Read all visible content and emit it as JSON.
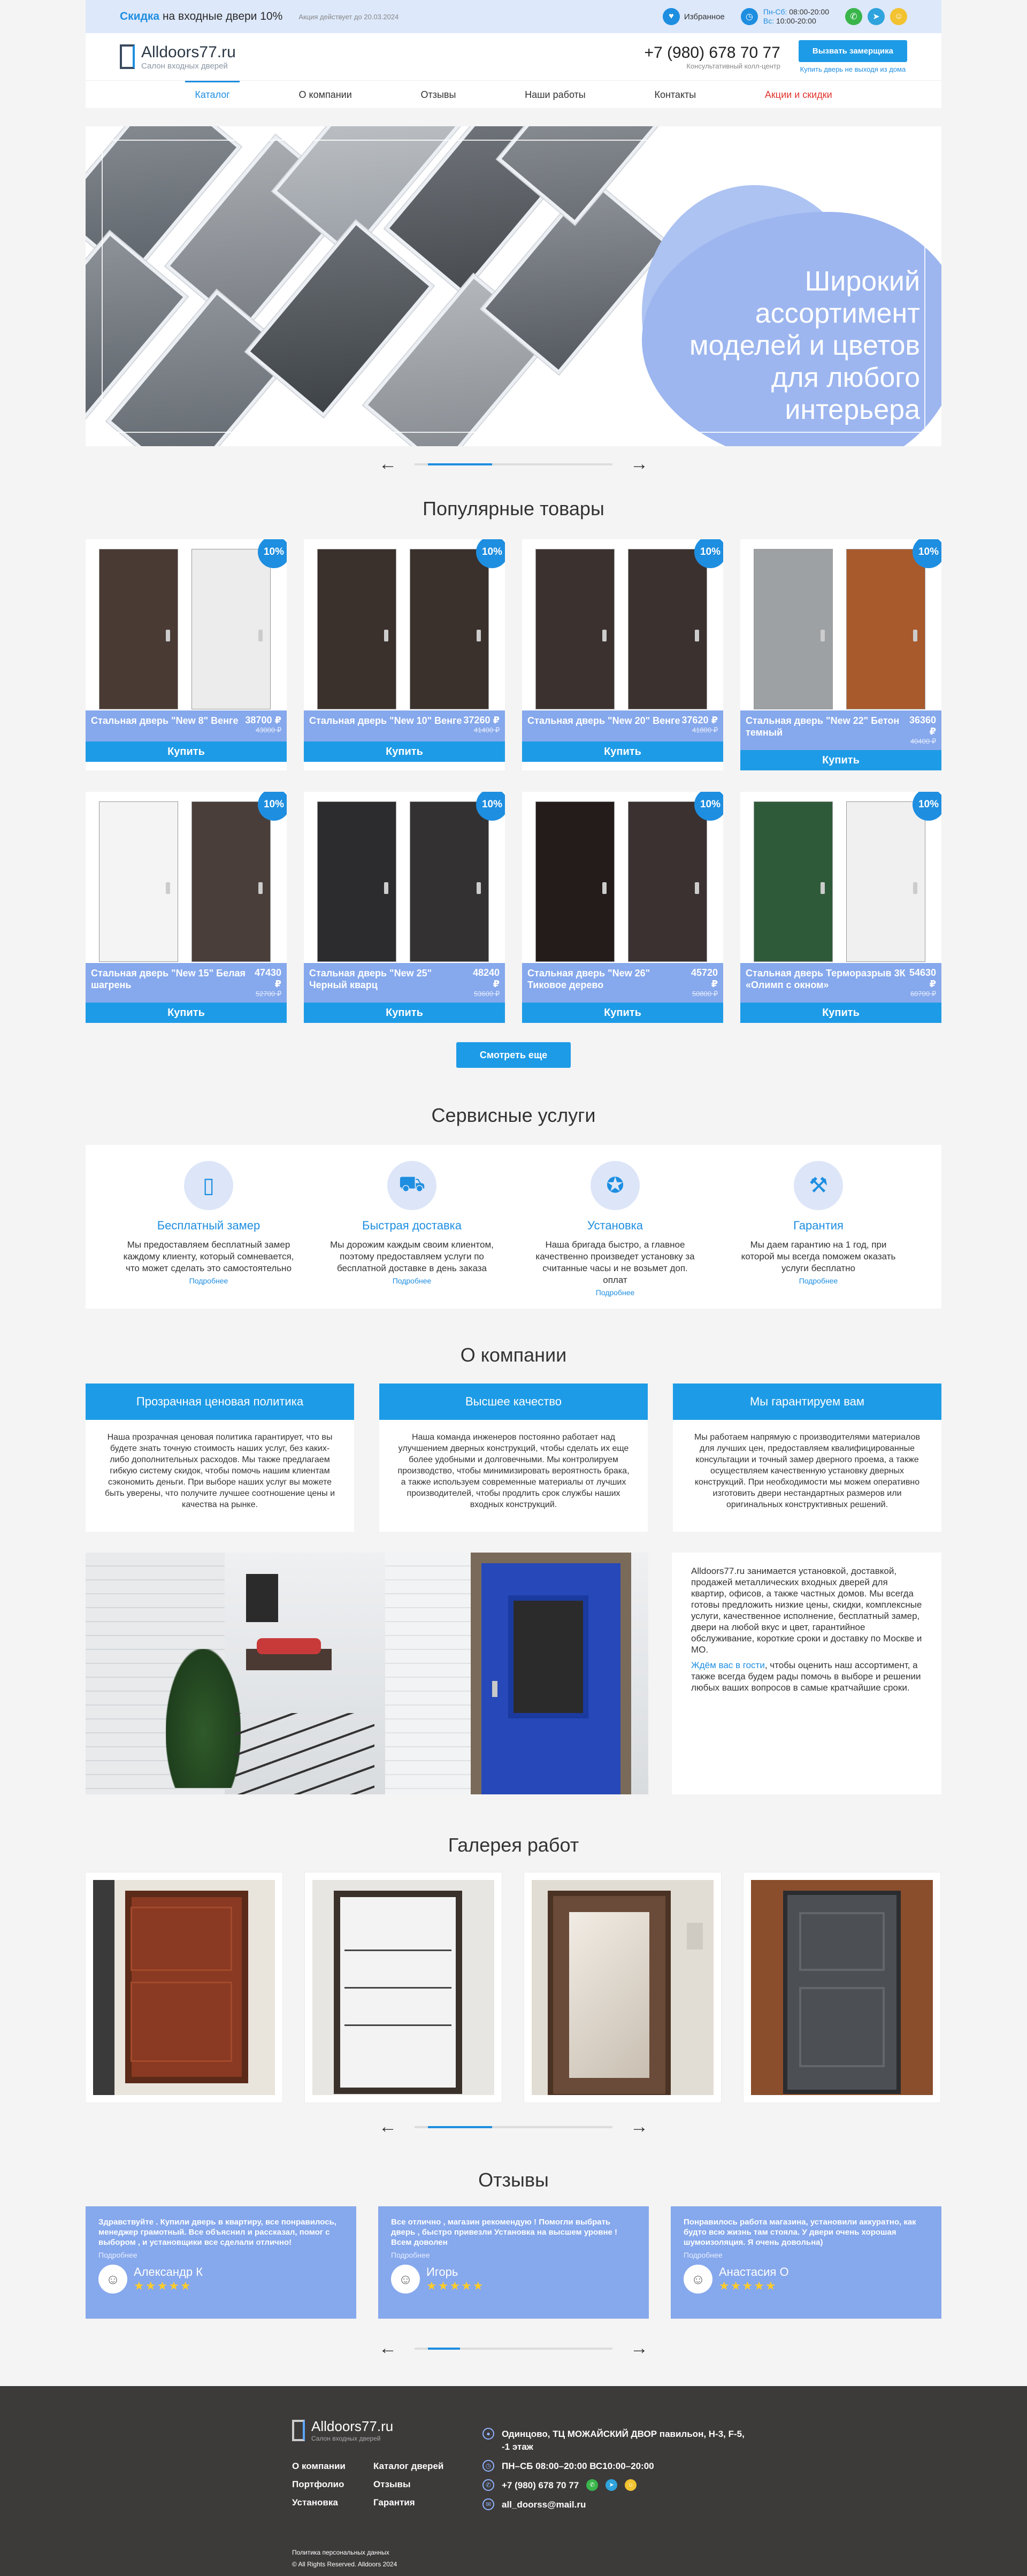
{
  "topbar": {
    "promo_highlight": "Скидка",
    "promo_text": " на входные двери 10%",
    "promo_sub": "Акция действует до 20.03.2024",
    "favorites_label": "Избранное",
    "hours_weekdays_label": "Пн-Сб:",
    "hours_weekdays": "08:00-20:00",
    "hours_sunday_label": "Вс:",
    "hours_sunday": "10:00-20:00"
  },
  "header": {
    "logo_title": "Alldoors77.ru",
    "logo_sub": "Салон входных дверей",
    "phone": "+7 (980) 678 70 77",
    "phone_sub": "Консультативный колл-центр",
    "call_button": "Вызвать замерщика",
    "call_sub": "Купить дверь не выходя из дома"
  },
  "nav": [
    "Каталог",
    "О компании",
    "Отзывы",
    "Наши работы",
    "Контакты",
    "Акции и скидки"
  ],
  "hero": {
    "text": "Широкий ассортимент моделей и цветов для любого интерьера"
  },
  "sections": {
    "popular": "Популярные товары",
    "services": "Сервисные услуги",
    "about": "О компании",
    "gallery": "Галерея работ",
    "reviews": "Отзывы"
  },
  "products": [
    {
      "name": "Стальная дверь \"New 8\" Венге",
      "price": "38700 ₽",
      "old": "43000 ₽",
      "badge": "10%",
      "buy": "Купить",
      "colors": [
        "#4a3a34",
        "#ececec"
      ]
    },
    {
      "name": "Стальная дверь \"New 10\" Венге",
      "price": "37260 ₽",
      "old": "41400 ₽",
      "badge": "10%",
      "buy": "Купить",
      "colors": [
        "#3a302c",
        "#3a302c"
      ]
    },
    {
      "name": "Стальная дверь \"New 20\" Венге",
      "price": "37620 ₽",
      "old": "41800 ₽",
      "badge": "10%",
      "buy": "Купить",
      "colors": [
        "#3b3230",
        "#3b3230"
      ]
    },
    {
      "name": "Стальная дверь \"New 22\" Бетон темный",
      "price": "36360 ₽",
      "old": "40400 ₽",
      "badge": "10%",
      "buy": "Купить",
      "colors": [
        "#9ea1a3",
        "#a85a2c"
      ]
    },
    {
      "name": "Стальная дверь \"New 15\" Белая шагрень",
      "price": "47430 ₽",
      "old": "52700 ₽",
      "badge": "10%",
      "buy": "Купить",
      "colors": [
        "#f4f4f4",
        "#4a3e3b"
      ]
    },
    {
      "name": "Стальная дверь \"New 25\" Черный кварц",
      "price": "48240 ₽",
      "old": "53600 ₽",
      "badge": "10%",
      "buy": "Купить",
      "colors": [
        "#2c2c2e",
        "#343133"
      ]
    },
    {
      "name": "Стальная дверь \"New 26\" Тиковое дерево",
      "price": "45720 ₽",
      "old": "50800 ₽",
      "badge": "10%",
      "buy": "Купить",
      "colors": [
        "#231c1a",
        "#3a3130"
      ]
    },
    {
      "name": "Стальная дверь Терморазрыв 3К «Олимп с окном»",
      "price": "54630 ₽",
      "old": "60700 ₽",
      "badge": "10%",
      "buy": "Купить",
      "colors": [
        "#2f5a3a",
        "#f0f0f0"
      ]
    }
  ],
  "more_button": "Смотреть еще",
  "services": [
    {
      "icon": "door-measure-icon",
      "title": "Бесплатный замер",
      "text": "Мы предоставляем бесплатный замер каждому клиенту, который сомневается, что может сделать это самостоятельно",
      "more": "Подробнее"
    },
    {
      "icon": "truck-icon",
      "title": "Быстрая доставка",
      "text": "Мы дорожим каждым своим клиентом, поэтому предоставляем услуги по бесплатной доставке в день заказа",
      "more": "Подробнее"
    },
    {
      "icon": "award-icon",
      "title": "Установка",
      "text": "Наша бригада быстро, а главное качественно произведет установку за считанные часы и не возьмет доп. оплат",
      "more": "Подробнее"
    },
    {
      "icon": "wrench-icon",
      "title": "Гарантия",
      "text": "Мы даем гарантию на 1 год, при которой мы всегда поможем оказать услуги бесплатно",
      "more": "Подробнее"
    }
  ],
  "about": [
    {
      "title": "Прозрачная ценовая политика",
      "text": "Наша прозрачная ценовая политика гарантирует, что вы будете знать точную стоимость наших услуг, без каких-либо дополнительных расходов. Мы также предлагаем гибкую систему скидок, чтобы помочь нашим клиентам сэкономить деньги. При выборе наших услуг вы можете быть уверены, что получите лучшее соотношение цены и качества на рынке."
    },
    {
      "title": "Высшее качество",
      "text": "Наша команда инженеров постоянно работает над улучшением дверных конструкций, чтобы сделать их еще более удобными и долговечными. Мы контролируем производство, чтобы минимизировать вероятность брака, а также используем современные материалы от лучших производителей, чтобы продлить срок службы наших входных конструкций."
    },
    {
      "title": "Мы гарантируем вам",
      "text": "Мы работаем напрямую с производителями материалов для лучших цен, предоставляем квалифицированные консультации и точный замер дверного проема, а также осуществляем качественную установку дверных конструкций. При необходимости мы можем оперативно изготовить двери нестандартных размеров или оригинальных конструктивных решений."
    }
  ],
  "about_text": {
    "p1": "Alldoors77.ru занимается установкой, доставкой, продажей металлических входных дверей для квартир, офисов, а также частных домов. Мы всегда готовы предложить низкие цены, скидки, комплексные услуги, качественное исполнение, бесплатный замер, двери на любой вкус и цвет, гарантийное обслуживание, короткие сроки и доставку по Москве и МО.",
    "link": "Ждём вас в гости",
    "p2": ", чтобы оценить наш ассортимент, а также всегда будем рады помочь в выборе и решении любых ваших вопросов в самые кратчайшие сроки."
  },
  "reviews": [
    {
      "text": "Здравствуйте . Купили дверь в квартиру, все понравилось, менеджер грамотный. Все объяснил и рассказал, помог с выбором , и установщики все сделали отлично!",
      "more": "Подробнее",
      "name": "Александр К",
      "stars": "★★★★★"
    },
    {
      "text": "Все отлично , магазин рекомендую ! Помогли выбрать дверь , быстро привезли Установка на высшем уровне ! Всем доволен",
      "more": "Подробнее",
      "name": "Игорь",
      "stars": "★★★★★"
    },
    {
      "text": "Понравилось работа магазина, установили аккуратно, как будто всю жизнь там стояла. У двери очень хорошая шумоизоляция. Я очень довольна)",
      "more": "Подробнее",
      "name": "Анастасия О",
      "stars": "★★★★★"
    }
  ],
  "footer": {
    "logo_title": "Alldoors77.ru",
    "logo_sub": "Салон входных дверей",
    "links": [
      "О компании",
      "Каталог дверей",
      "Портфолио",
      "Отзывы",
      "Установка",
      "Гарантия"
    ],
    "policy": "Политика персональных данных",
    "rights": "© All Rights Reserved. Alldoors 2024",
    "address": "Одинцово, ТЦ МОЖАЙСКИЙ ДВОР павильон, Н-3, F-5, -1 этаж",
    "hours": "ПН–СБ 08:00–20:00   ВС10:00–20:00",
    "phone": "+7 (980) 678 70 77",
    "email": "all_doorss@mail.ru"
  },
  "colors": {
    "accent": "#1e9be6",
    "card": "#86a8ec",
    "promo_red": "#e0342e"
  }
}
